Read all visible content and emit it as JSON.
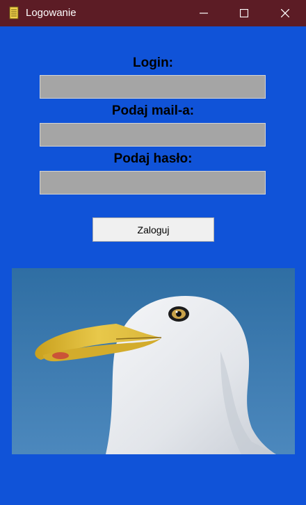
{
  "window": {
    "title": "Logowanie",
    "app_icon": "notebook-icon",
    "controls": [
      "minimize-icon",
      "maximize-icon",
      "close-icon"
    ]
  },
  "form": {
    "login_label": "Login:",
    "login_value": "",
    "email_label": "Podaj mail-a:",
    "email_value": "",
    "password_label": "Podaj hasło:",
    "password_value": "",
    "submit_label": "Zaloguj"
  },
  "image": {
    "subject": "seagull-head-photo"
  },
  "colors": {
    "background": "#1053d8",
    "titlebar": "#5c1c25",
    "field": "#a5a5a5",
    "button": "#f0f0f0"
  }
}
